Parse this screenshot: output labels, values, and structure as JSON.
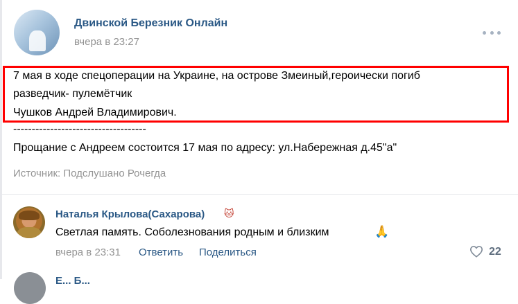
{
  "post": {
    "group_name": "Двинской Березник Онлайн",
    "time": "вчера в 23:27",
    "avatar_text": "Двинской Березник Онлайн",
    "lines": [
      "7 мая в ходе спецоперации на Украине, на острове Змеиный,героически погиб",
      "разведчик- пулемётчик",
      "Чушков Андрей Владимирович.",
      "------------------------------------",
      "Прощание с Андреем состоится 17 мая по адресу: ул.Набережная д.45\"а\""
    ],
    "source": "Источник: Подслушано Рочегда",
    "highlight_color": "#ff0000"
  },
  "comment": {
    "author": "Наталья Крылова(Сахарова)",
    "author_emoji": "cat-face-icon",
    "text": "Светлая память. Соболезнования родным и близким",
    "text_emoji": "folded-hands-icon",
    "time": "вчера в 23:31",
    "reply_label": "Ответить",
    "share_label": "Поделиться",
    "likes": "22"
  },
  "next_comment": {
    "author": "Е... Б..."
  },
  "colors": {
    "link": "#2a5885",
    "muted": "#939393"
  }
}
